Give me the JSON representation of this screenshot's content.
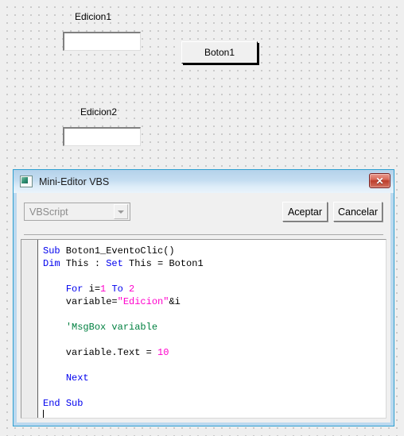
{
  "designer": {
    "labels": [
      {
        "text": "Edicion1",
        "name": "label-edicion1"
      },
      {
        "text": "Edicion2",
        "name": "label-edicion2"
      }
    ],
    "textboxes": [
      {
        "value": "",
        "name": "textbox-edicion1"
      },
      {
        "value": "",
        "name": "textbox-edicion2"
      }
    ],
    "button": {
      "label": "Boton1"
    }
  },
  "dialog": {
    "title": "Mini-Editor VBS",
    "icon": "window-screen-icon",
    "close_glyph": "✕",
    "close_label": "Close",
    "toolbar": {
      "language_combo": {
        "value": "VBScript",
        "options": [
          "VBScript"
        ],
        "disabled": true
      },
      "accept_label": "Aceptar",
      "cancel_label": "Cancelar"
    },
    "editor": {
      "lines": [
        "Sub Boton1_EventoClic()",
        "Dim This : Set This = Boton1",
        "",
        "    For i=1 To 2",
        "    variable=\"Edicion\"&i",
        "",
        "    'MsgBox variable",
        "",
        "    variable.Text = 10",
        "",
        "    Next",
        "",
        "End Sub",
        ""
      ]
    }
  },
  "colors": {
    "keyword": "#0000ee",
    "number": "#ff00cc",
    "string": "#ff00cc",
    "comment": "#008040",
    "titlebar_start": "#b4d2ea",
    "titlebar_end": "#eaf3fb",
    "dialog_border": "#bcd9ef",
    "dialog_edge": "#2f9fd0",
    "close_red": "#bb3e2c",
    "canvas_bg": "#efefef",
    "grid_dot": "#5a5a5a"
  }
}
